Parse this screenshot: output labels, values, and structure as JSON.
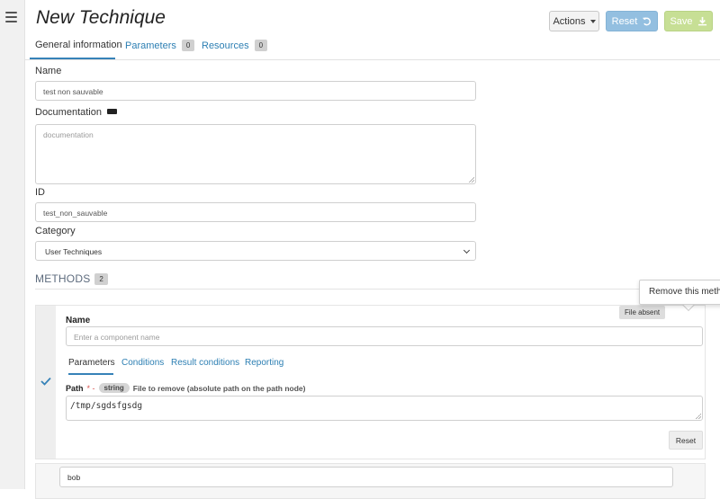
{
  "header": {
    "title": "New Technique",
    "actions_label": "Actions",
    "reset_label": "Reset",
    "save_label": "Save"
  },
  "tabs": [
    {
      "label": "General information"
    },
    {
      "label": "Parameters",
      "count": "0"
    },
    {
      "label": "Resources",
      "count": "0"
    }
  ],
  "form": {
    "name_label": "Name",
    "name_value": "test non sauvable",
    "documentation_label": "Documentation",
    "documentation_placeholder": "documentation",
    "id_label": "ID",
    "id_value": "test_non_sauvable",
    "category_label": "Category",
    "category_value": "User Techniques"
  },
  "methods": {
    "title": "METHODS",
    "count": "2",
    "popover": "Remove this metho",
    "file_tooltip": "File absent",
    "card": {
      "name_label": "Name",
      "name_placeholder": "Enter a component name",
      "tabs": [
        "Parameters",
        "Conditions",
        "Result conditions",
        "Reporting"
      ],
      "path_label": "Path",
      "required_mark": "* -",
      "type_badge": "string",
      "path_description": "File to remove (absolute path on the path node)",
      "path_value": "/tmp/sgdsfgsdg",
      "reset_label": "Reset"
    },
    "second_card_value": "bob"
  },
  "colors": {
    "accent": "#3682b8",
    "reset_btn": "#93bfe0",
    "save_btn": "#c7df95"
  }
}
